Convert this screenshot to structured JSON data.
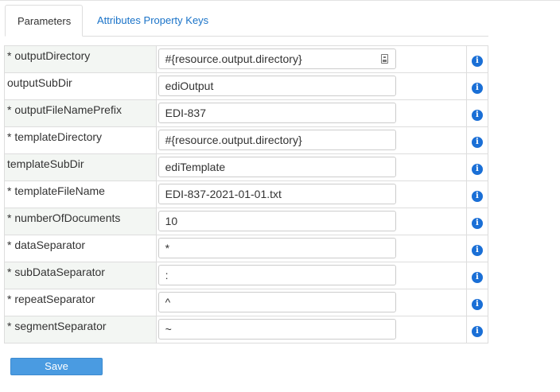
{
  "tabs": [
    {
      "label": "Parameters",
      "active": true
    },
    {
      "label": "Attributes Property Keys",
      "active": false
    }
  ],
  "params": [
    {
      "label": "* outputDirectory",
      "value": "#{resource.output.directory}",
      "picker": true
    },
    {
      "label": "outputSubDir",
      "value": "ediOutput"
    },
    {
      "label": "* outputFileNamePrefix",
      "value": "EDI-837"
    },
    {
      "label": "* templateDirectory",
      "value": "#{resource.output.directory}"
    },
    {
      "label": "templateSubDir",
      "value": "ediTemplate"
    },
    {
      "label": "* templateFileName",
      "value": "EDI-837-2021-01-01.txt"
    },
    {
      "label": "* numberOfDocuments",
      "value": "10"
    },
    {
      "label": "* dataSeparator",
      "value": "*"
    },
    {
      "label": "* subDataSeparator",
      "value": ":"
    },
    {
      "label": "* repeatSeparator",
      "value": "^"
    },
    {
      "label": "* segmentSeparator",
      "value": "~"
    }
  ],
  "info_icon": {
    "glyph": "i",
    "color": "#1a6fd6"
  },
  "save_label": "Save",
  "colors": {
    "accent": "#4a9be1",
    "link": "#1a73c8"
  }
}
